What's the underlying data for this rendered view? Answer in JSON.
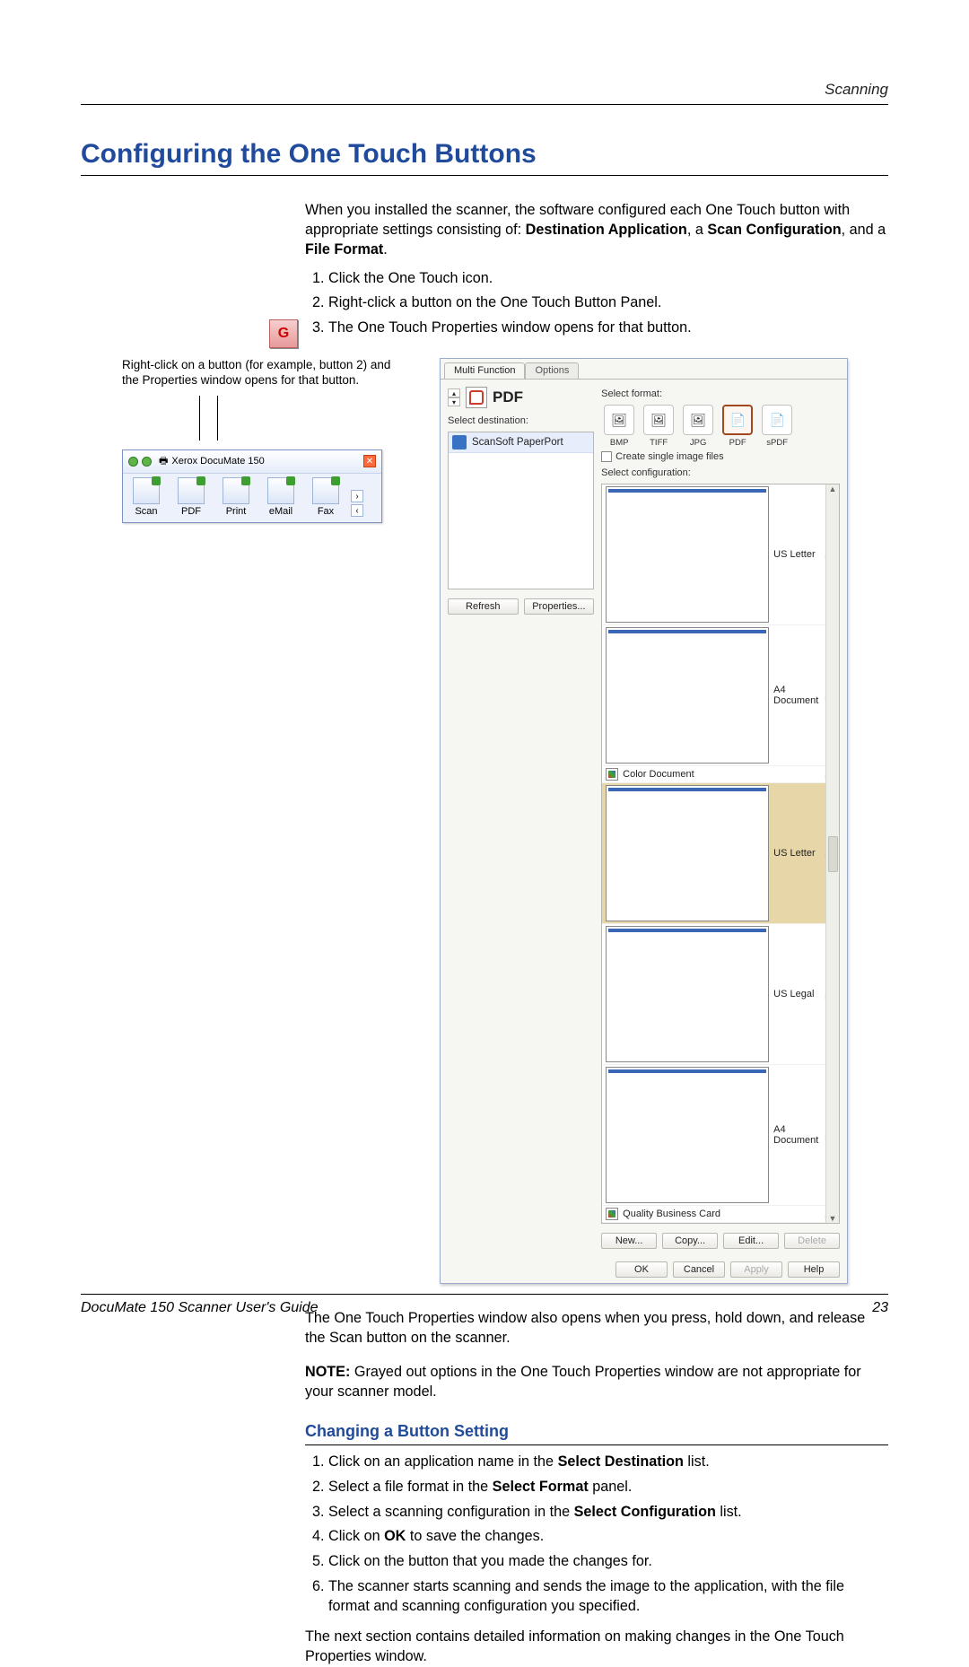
{
  "header": {
    "section": "Scanning"
  },
  "h1": "Configuring the One Touch Buttons",
  "intro": {
    "text_a": "When you installed the scanner, the software configured each One Touch button with appropriate settings consisting of: ",
    "bold_a": "Destination Application",
    "text_b": ", a ",
    "bold_b": "Scan Configuration",
    "text_c": ", and a ",
    "bold_c": "File Format",
    "text_d": "."
  },
  "steps_top": [
    "Click the One Touch icon.",
    "Right-click a button on the One Touch Button Panel.",
    "The One Touch Properties window opens for that button."
  ],
  "figure": {
    "callout": "Right-click on a button (for example, button 2) and the Properties window opens for that button.",
    "panel_title": "Xerox DocuMate 150",
    "panel_buttons": [
      "Scan",
      "PDF",
      "Print",
      "eMail",
      "Fax"
    ],
    "dialog": {
      "tabs": [
        "Multi Function",
        "Options"
      ],
      "pdf_label": "PDF",
      "select_destination_label": "Select destination:",
      "destination_item": "ScanSoft PaperPort",
      "refresh": "Refresh",
      "properties": "Properties...",
      "select_format_label": "Select format:",
      "formats": [
        "BMP",
        "TIFF",
        "JPG",
        "PDF",
        "sPDF"
      ],
      "create_single": "Create single image files",
      "select_config_label": "Select configuration:",
      "configs": [
        {
          "label": "US Letter",
          "kind": "page",
          "selected": false
        },
        {
          "label": "A4 Document",
          "kind": "page",
          "selected": false
        },
        {
          "label": "Color Document",
          "kind": "color",
          "selected": false
        },
        {
          "label": "US Letter",
          "kind": "page",
          "selected": true
        },
        {
          "label": "US Legal",
          "kind": "page",
          "selected": false
        },
        {
          "label": "A4 Document",
          "kind": "page",
          "selected": false
        },
        {
          "label": "Quality Business Card",
          "kind": "color",
          "selected": false
        }
      ],
      "new": "New...",
      "copy": "Copy...",
      "edit": "Edit...",
      "delete": "Delete",
      "ok": "OK",
      "cancel": "Cancel",
      "apply": "Apply",
      "help": "Help"
    }
  },
  "after_figure_p1": "The One Touch Properties window also opens when you press, hold down, and release the Scan button on the scanner.",
  "note_label": "NOTE:",
  "note_text": "  Grayed out options in the One Touch Properties window are not appropriate for your scanner model.",
  "subhead": "Changing a Button Setting",
  "steps_change": {
    "s1a": "Click on an application name in the ",
    "s1b": "Select Destination",
    "s1c": " list.",
    "s2a": "Select a file format in the ",
    "s2b": "Select Format",
    "s2c": " panel.",
    "s3a": "Select a scanning configuration in the ",
    "s3b": "Select Configuration",
    "s3c": " list.",
    "s4a": "Click on ",
    "s4b": "OK",
    "s4c": " to save the changes.",
    "s5": "Click on the button that you made the changes for.",
    "s6": "The scanner starts scanning and sends the image to the application, with the file format and scanning configuration you specified."
  },
  "closing": "The next section contains detailed information on making changes in the One Touch Properties window.",
  "footer": {
    "left": "DocuMate 150 Scanner User's Guide",
    "page": "23"
  },
  "app_icon_glyph": "G"
}
